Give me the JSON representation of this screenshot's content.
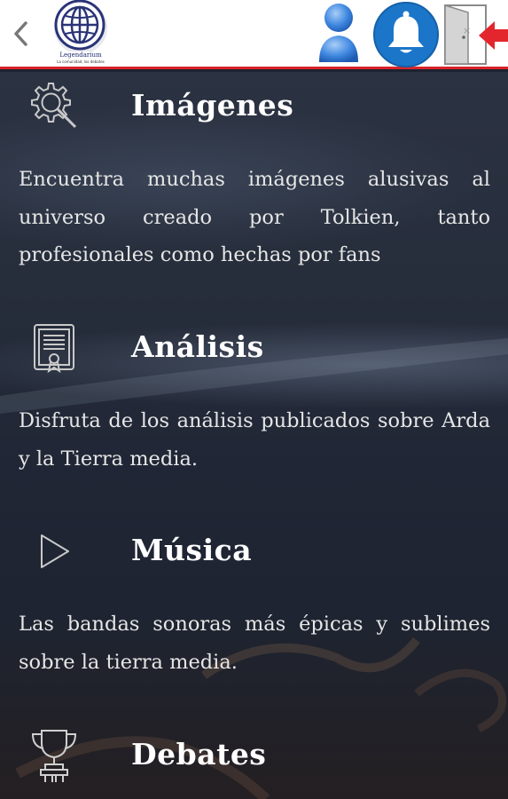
{
  "header": {
    "logo_name": "Legendarium",
    "logo_tagline": "La comunidad, los debates"
  },
  "icons": {
    "back": "chevron-left-icon",
    "user": "user-icon",
    "bell": "bell-icon",
    "exit": "exit-door-icon"
  },
  "colors": {
    "accent_red": "#d8232a",
    "bell_blue": "#1b76c9",
    "user_blue": "#3b82e0",
    "text": "#ffffff"
  },
  "sections": [
    {
      "icon": "search-gear-icon",
      "title": "Imágenes",
      "description": "Encuentra muchas imágenes alusivas al universo creado por Tolkien, tanto profesionales como hechas por fans"
    },
    {
      "icon": "certificate-icon",
      "title": "Análisis",
      "description": "Disfruta de los análisis publicados sobre Arda y la Tierra media."
    },
    {
      "icon": "play-icon",
      "title": "Música",
      "description": "Las bandas sonoras más épicas y sublimes sobre la tierra media."
    },
    {
      "icon": "trophy-icon",
      "title": "Debates",
      "description": ""
    }
  ]
}
